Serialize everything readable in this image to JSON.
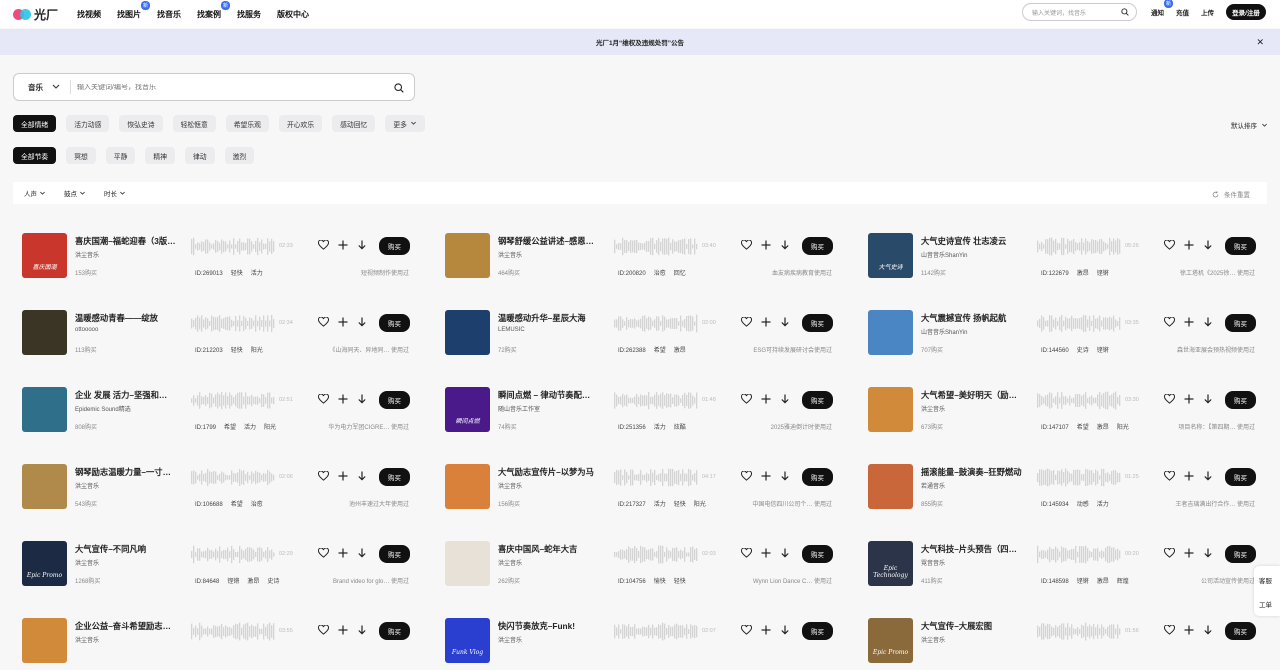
{
  "nav": {
    "logo": "光厂",
    "items": [
      {
        "label": "找视频"
      },
      {
        "label": "找图片",
        "badge": "新"
      },
      {
        "label": "找音乐"
      },
      {
        "label": "找案例",
        "badge": "新"
      },
      {
        "label": "找服务"
      },
      {
        "label": "版权中心"
      }
    ],
    "search_placeholder": "输入关键词，找音乐",
    "right": [
      {
        "label": "通知",
        "badge": "新"
      },
      {
        "label": "充值"
      },
      {
        "label": "上传"
      }
    ],
    "login": "登录/注册"
  },
  "announcement": {
    "text": "光厂1月“维权及违规处罚”公告",
    "close": "✕"
  },
  "search": {
    "category": "音乐",
    "placeholder": "输入关键词/编号，找音乐"
  },
  "mood_chips": [
    "全部情绪",
    "活力动感",
    "恢弘史诗",
    "轻松惬意",
    "希望乐观",
    "开心欢乐",
    "感动回忆",
    "更多"
  ],
  "rhythm_chips": [
    "全部节奏",
    "冥想",
    "平静",
    "精神",
    "律动",
    "激烈"
  ],
  "sort_label": "默认排序",
  "filters": [
    "人声",
    "鼓点",
    "时长"
  ],
  "reset_label": "条件重置",
  "buy_label": "购买",
  "colors": {
    "accent": "#111111",
    "badge": "#3a6df0",
    "announcement_bg": "#e6e8f7"
  },
  "tracks": [
    {
      "title": "喜庆国潮–福蛇迎春（3版…",
      "author": "洪尘音乐",
      "buys": "153购买",
      "id": "ID:269013",
      "tags": [
        "轻快",
        "活力"
      ],
      "duration": "02:33",
      "usage": "短视频制作使用过",
      "thumb": "#c9362b",
      "thumb_text": "喜庆国潮"
    },
    {
      "title": "钢琴舒缓公益讲述–感恩…",
      "author": "洪尘音乐",
      "buys": "464购买",
      "id": "ID:200820",
      "tags": [
        "治愈",
        "回忆"
      ],
      "duration": "03:40",
      "usage": "血友病疾病教育使用过",
      "thumb": "#b5883e",
      "thumb_text": ""
    },
    {
      "title": "大气史诗宣传 壮志凌云",
      "author": "山音音乐ShanYin",
      "buys": "1142购买",
      "id": "ID:122679",
      "tags": [
        "激昂",
        "铿锵"
      ],
      "duration": "05:26",
      "usage": "徐工塔机《2025徐… 使用过",
      "thumb": "#2a4a6a",
      "thumb_text": "大气史诗"
    },
    {
      "title": "温暖感动青春——绽放",
      "author": "ottooooo",
      "buys": "113购买",
      "id": "ID:212203",
      "tags": [
        "轻快",
        "阳光"
      ],
      "duration": "02:34",
      "usage": "《山海同天、异地同… 使用过",
      "thumb": "#3a3524",
      "thumb_text": ""
    },
    {
      "title": "温暖感动升华–星辰大海",
      "author": "LEMUSIC",
      "buys": "72购买",
      "id": "ID:262388",
      "tags": [
        "希望",
        "激昂"
      ],
      "duration": "02:00",
      "usage": "ESG可持续发展研讨会使用过",
      "thumb": "#1c3f6e",
      "thumb_text": ""
    },
    {
      "title": "大气震撼宣传 扬帆起航",
      "author": "山音音乐ShanYin",
      "buys": "707购买",
      "id": "ID:144560",
      "tags": [
        "史诗",
        "铿锵"
      ],
      "duration": "03:35",
      "usage": "森世海亚展会预热视频使用过",
      "thumb": "#4a86c4",
      "thumb_text": ""
    },
    {
      "title": "企业 发展 活力–坚强和…",
      "author": "Epidemic Sound精选",
      "buys": "808购买",
      "id": "ID:1799",
      "tags": [
        "希望",
        "活力",
        "阳光"
      ],
      "duration": "02:51",
      "usage": "华为电力军团CIGRE… 使用过",
      "thumb": "#2f6f8a",
      "thumb_text": ""
    },
    {
      "title": "瞬间点燃 – 律动节奏配…",
      "author": "随山音乐工作室",
      "buys": "74购买",
      "id": "ID:251356",
      "tags": [
        "活力",
        "炫酷"
      ],
      "duration": "01:48",
      "usage": "2025雅迪倒计时使用过",
      "thumb": "#4a1a8a",
      "thumb_text": "瞬间点燃"
    },
    {
      "title": "大气希望–美好明天（励…",
      "author": "洪尘音乐",
      "buys": "673购买",
      "id": "ID:147107",
      "tags": [
        "希望",
        "激昂",
        "阳光"
      ],
      "duration": "03:30",
      "usage": "项目名称：【第四期… 使用过",
      "thumb": "#d08a3a",
      "thumb_text": ""
    },
    {
      "title": "钢琴励志温暖力量–一寸…",
      "author": "洪尘音乐",
      "buys": "543购买",
      "id": "ID:106688",
      "tags": [
        "希望",
        "治愈"
      ],
      "duration": "02:06",
      "usage": "池州丰速过大年使用过",
      "thumb": "#b08a4a",
      "thumb_text": ""
    },
    {
      "title": "大气励志宣传片–以梦为马",
      "author": "洪尘音乐",
      "buys": "156购买",
      "id": "ID:217327",
      "tags": [
        "活力",
        "轻快",
        "阳光"
      ],
      "duration": "04:17",
      "usage": "中国电信四川公司个… 使用过",
      "thumb": "#d9813a",
      "thumb_text": ""
    },
    {
      "title": "摇滚能量–鼓演奏–狂野燃动",
      "author": "若通音乐",
      "buys": "855购买",
      "id": "ID:145934",
      "tags": [
        "动感",
        "活力"
      ],
      "duration": "01:25",
      "usage": "王者吉璃满出行合作… 使用过",
      "thumb": "#c9663a",
      "thumb_text": ""
    },
    {
      "title": "大气宣传–不同凡响",
      "author": "洪尘音乐",
      "buys": "1268购买",
      "id": "ID:84648",
      "tags": [
        "铿锵",
        "激昂",
        "史诗"
      ],
      "duration": "02:29",
      "usage": "Brand video for glo… 使用过",
      "thumb": "#1c2a44",
      "thumb_text": "Epic Promo"
    },
    {
      "title": "喜庆中国风–蛇年大吉",
      "author": "洪尘音乐",
      "buys": "262购买",
      "id": "ID:104756",
      "tags": [
        "愉快",
        "轻快"
      ],
      "duration": "02:03",
      "usage": "Wynn Lion Dance C… 使用过",
      "thumb": "#e8e1d8",
      "thumb_text": ""
    },
    {
      "title": "大气科技–片头预告（四…",
      "author": "霓音音乐",
      "buys": "411购买",
      "id": "ID:148598",
      "tags": [
        "铿锵",
        "激昂",
        "辉煌"
      ],
      "duration": "00:20",
      "usage": "公司活动宣传使用过",
      "thumb": "#2b3448",
      "thumb_text": "Epic Technology"
    },
    {
      "title": "企业公益–奋斗希望励志…",
      "author": "洪尘音乐",
      "buys": "",
      "id": "",
      "tags": [],
      "duration": "03:55",
      "usage": "",
      "thumb": "#d08a3a",
      "thumb_text": ""
    },
    {
      "title": "快闪节奏放克–Funk!",
      "author": "洪尘音乐",
      "buys": "",
      "id": "",
      "tags": [],
      "duration": "02:07",
      "usage": "",
      "thumb": "#2a3fd0",
      "thumb_text": "Funk Vlog"
    },
    {
      "title": "大气宣传–大展宏图",
      "author": "洪尘音乐",
      "buys": "",
      "id": "",
      "tags": [],
      "duration": "01:56",
      "usage": "",
      "thumb": "#8a6a3a",
      "thumb_text": "Epic Promo"
    }
  ],
  "side_tools": [
    "客服",
    "工单"
  ]
}
